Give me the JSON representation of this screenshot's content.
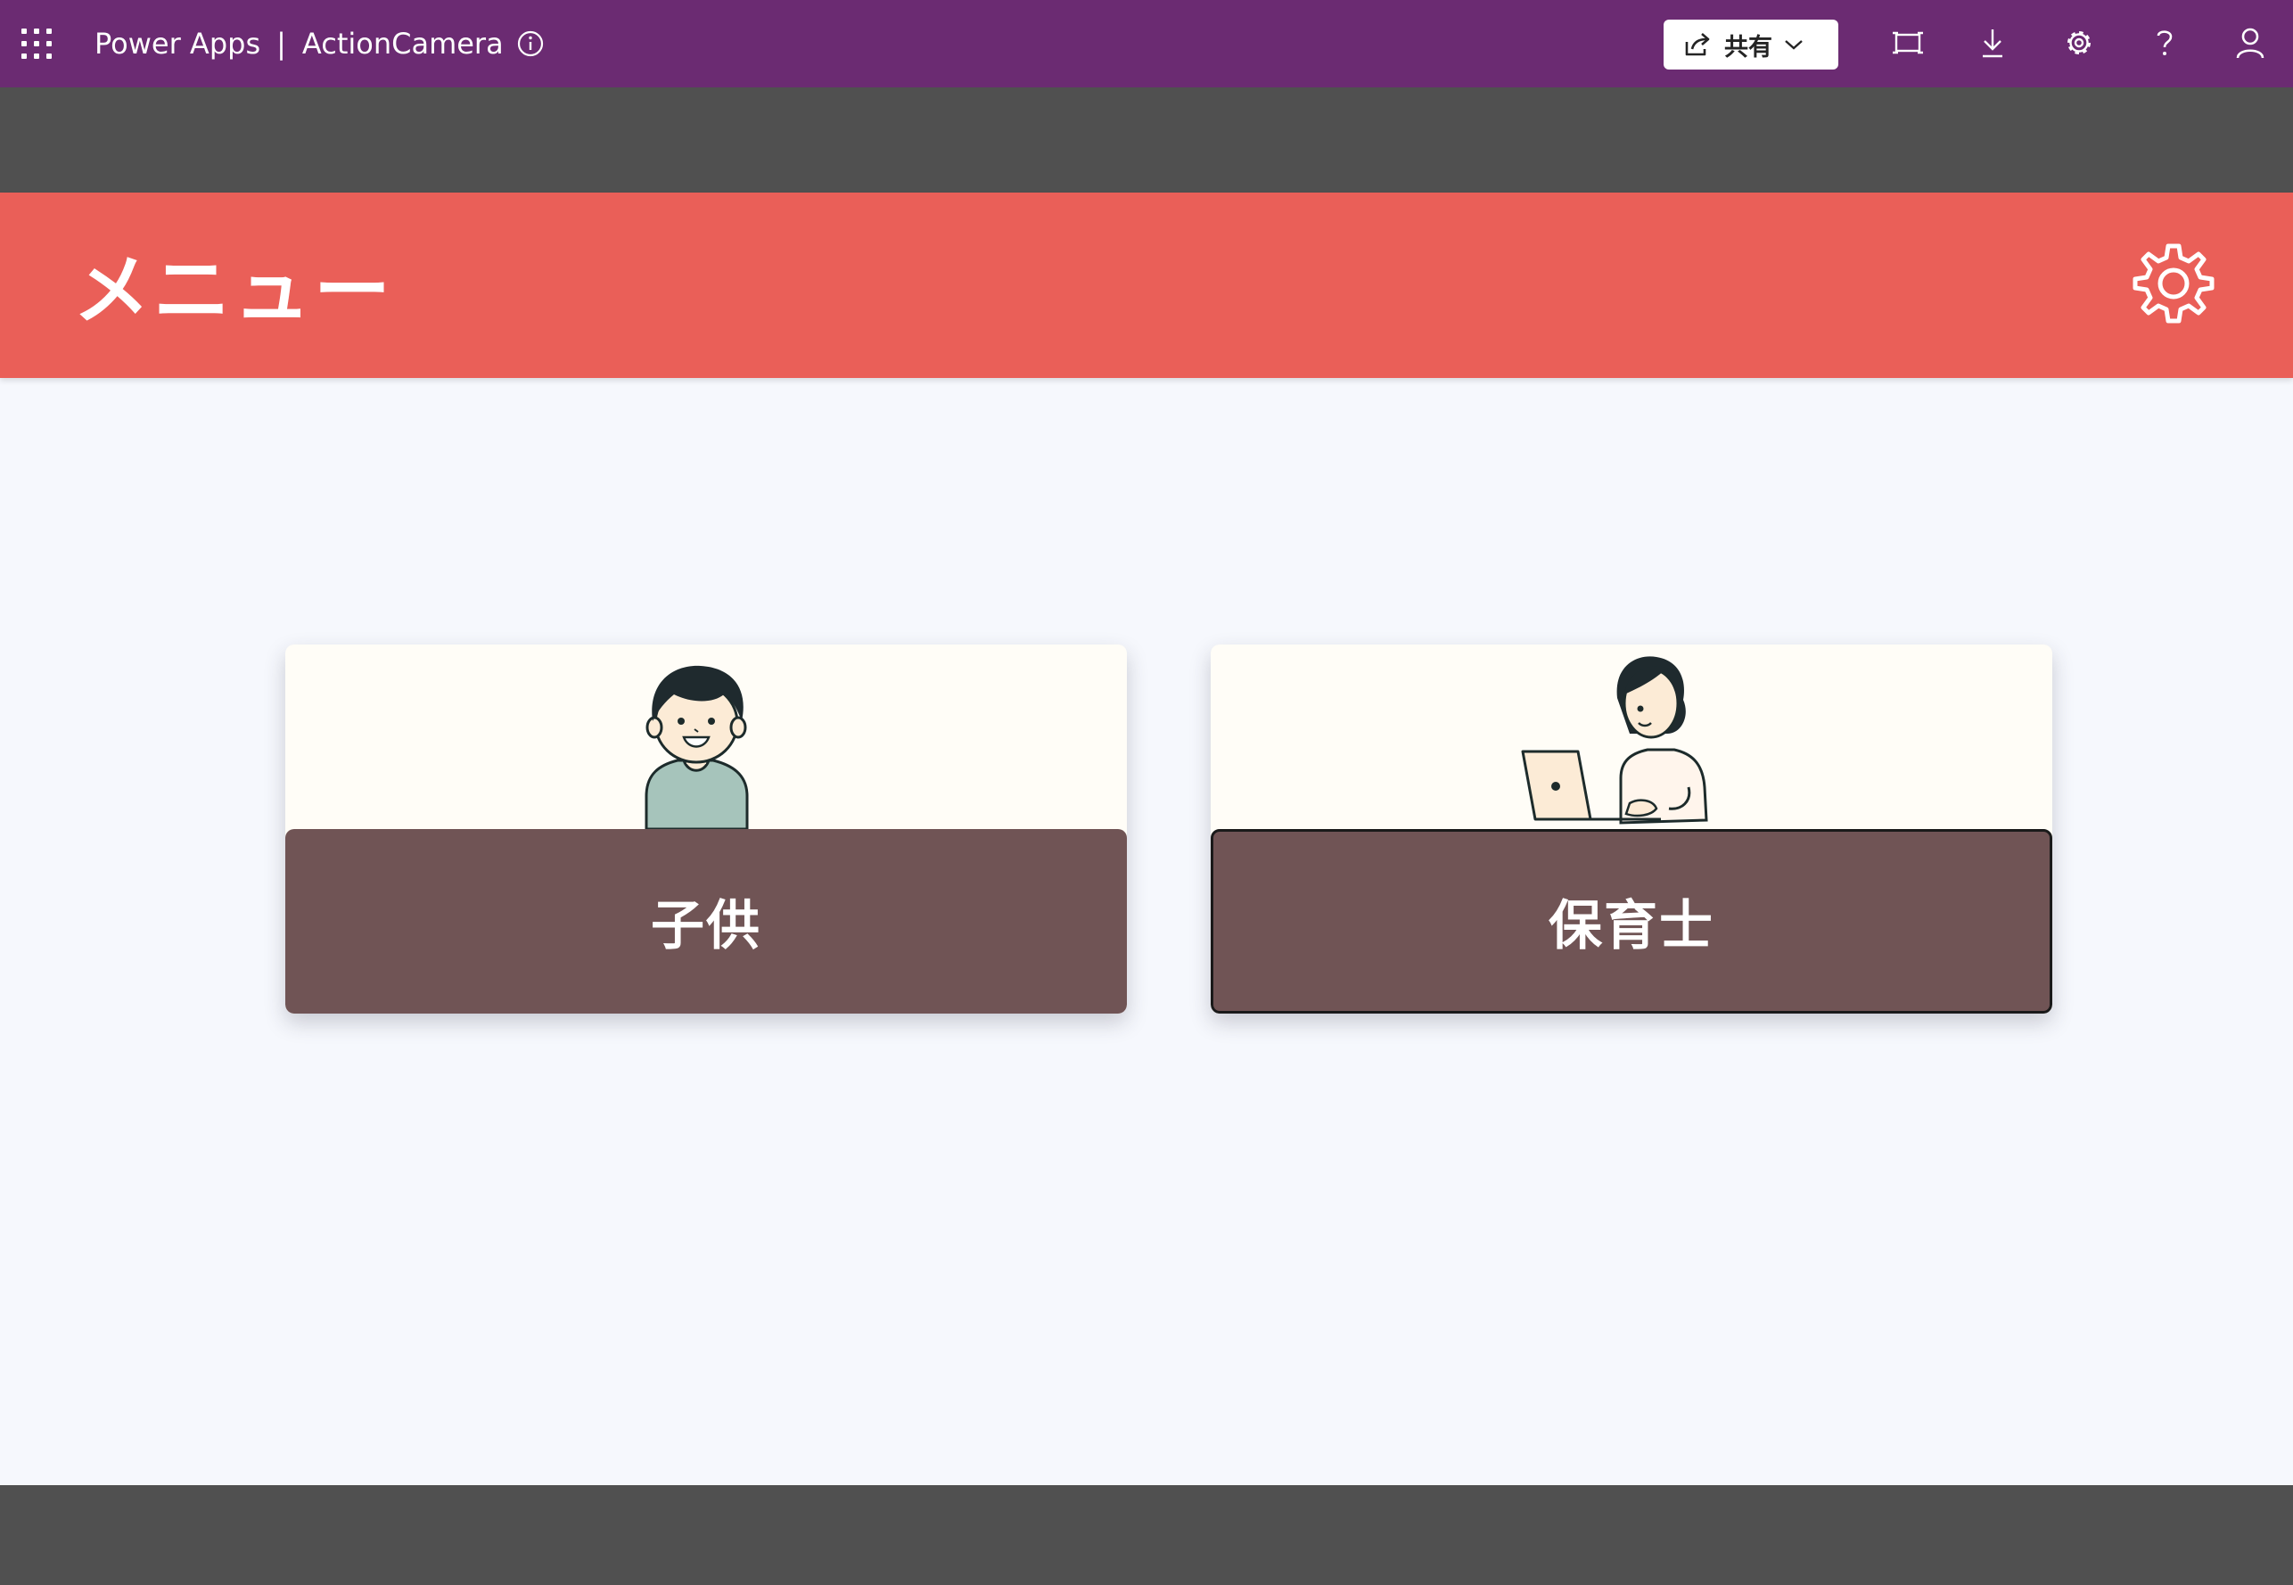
{
  "topbar": {
    "product": "Power Apps",
    "separator": "|",
    "app_name": "ActionCamera",
    "share_label": "共有",
    "icons": [
      "waffle-icon",
      "info-icon",
      "share-icon",
      "chevron-down-icon",
      "fit-screen-icon",
      "download-icon",
      "gear-icon",
      "help-icon",
      "person-icon"
    ]
  },
  "header": {
    "title": "メニュー",
    "icon": "gear-icon"
  },
  "menu": {
    "items": [
      {
        "label": "子供",
        "illustration": "child-illustration"
      },
      {
        "label": "保育士",
        "illustration": "teacher-illustration"
      }
    ]
  },
  "colors": {
    "topbar": "#6b2b72",
    "header": "#ea5f58",
    "card_label_bg": "#705455",
    "screen_bg": "#f6f8fd",
    "frame_gray": "#505050"
  }
}
